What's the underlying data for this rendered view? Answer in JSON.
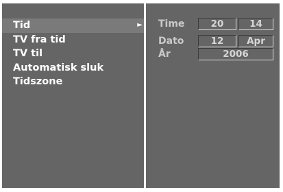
{
  "menu": {
    "items": [
      {
        "label": "Tid"
      },
      {
        "label": "TV fra tid"
      },
      {
        "label": "TV til"
      },
      {
        "label": "Automatisk sluk"
      },
      {
        "label": "Tidszone"
      }
    ],
    "selected_arrow": "►"
  },
  "time_settings": {
    "time_label": "Time",
    "hour": "20",
    "minute": "14",
    "date_label": "Dato",
    "day": "12",
    "month": "Apr",
    "year_label": "År",
    "year": "2006"
  },
  "colors": {
    "panel_background": "#656565",
    "selected_row": "#7a7a7a",
    "divider": "#ffffff",
    "menu_text": "#ffffff",
    "label_text": "#c9c9c9"
  }
}
